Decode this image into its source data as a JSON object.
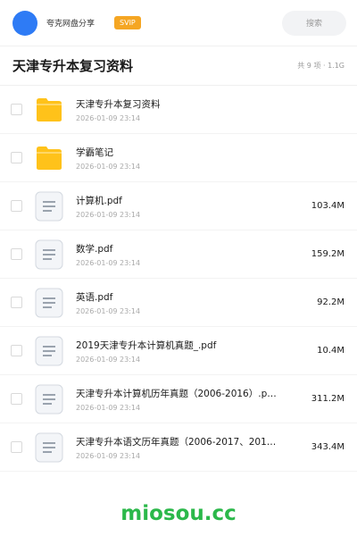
{
  "header": {
    "user_name": "夸克网盘分享",
    "badge": "SVIP",
    "search_placeholder": "搜索"
  },
  "folder": {
    "title": "天津专升本复习资料",
    "summary": "共 9 项 · 1.1G"
  },
  "files": [
    {
      "type": "folder",
      "name": "天津专升本复习资料",
      "date": "2026-01-09 23:14",
      "size": ""
    },
    {
      "type": "folder",
      "name": "学霸笔记",
      "date": "2026-01-09 23:14",
      "size": ""
    },
    {
      "type": "document",
      "name": "计算机.pdf",
      "date": "2026-01-09 23:14",
      "size": "103.4M"
    },
    {
      "type": "document",
      "name": "数学.pdf",
      "date": "2026-01-09 23:14",
      "size": "159.2M"
    },
    {
      "type": "document",
      "name": "英语.pdf",
      "date": "2026-01-09 23:14",
      "size": "92.2M"
    },
    {
      "type": "document",
      "name": "2019天津专升本计算机真题_.pdf",
      "date": "2026-01-09 23:14",
      "size": "10.4M"
    },
    {
      "type": "document",
      "name": "天津专升本计算机历年真题（2006-2016）.p…",
      "date": "2026-01-09 23:14",
      "size": "311.2M"
    },
    {
      "type": "document",
      "name": "天津专升本语文历年真题（2006-2017、201…",
      "date": "2026-01-09 23:14",
      "size": "343.4M"
    }
  ],
  "watermark": "miosou.cc",
  "colors": {
    "avatar": "#2e7bf5",
    "badge": "#f5a623",
    "folder_icon": "#ffc21a",
    "watermark": "#2bb84a"
  }
}
